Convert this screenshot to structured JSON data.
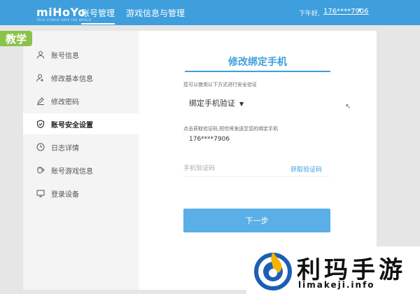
{
  "header": {
    "logo": "miHoYo",
    "logo_sub": "TECH OTAKUS SAVE THE WORLD",
    "nav": [
      {
        "label": "账号管理",
        "active": true
      },
      {
        "label": "游戏信息与管理",
        "active": false
      }
    ],
    "greeting": "下午好,",
    "user": "176****7906"
  },
  "badge": "教学",
  "sidebar": {
    "items": [
      {
        "label": "账号信息",
        "icon": "user-icon"
      },
      {
        "label": "修改基本信息",
        "icon": "user-edit-icon"
      },
      {
        "label": "修改密码",
        "icon": "pencil-icon"
      },
      {
        "label": "账号安全设置",
        "icon": "shield-icon",
        "active": true
      },
      {
        "label": "日志详情",
        "icon": "clock-icon"
      },
      {
        "label": "账号游戏信息",
        "icon": "cup-icon"
      },
      {
        "label": "登录设备",
        "icon": "monitor-icon"
      }
    ]
  },
  "form": {
    "title": "修改绑定手机",
    "verify_hint": "您可以使用以下方式进行安全验证",
    "method": "绑定手机验证",
    "sms_hint": "点击获取验证码,短信将发送至您的绑定手机",
    "phone": "176****7906",
    "code_placeholder": "手机验证码",
    "get_code": "获取验证码",
    "next": "下一步"
  },
  "watermark": {
    "text": "利玛手游",
    "url": "limakeji.info"
  },
  "colors": {
    "header": "#3e9fdc",
    "accent": "#3e9fdc",
    "button": "#5aafe6",
    "badge": "#8bc34a"
  }
}
